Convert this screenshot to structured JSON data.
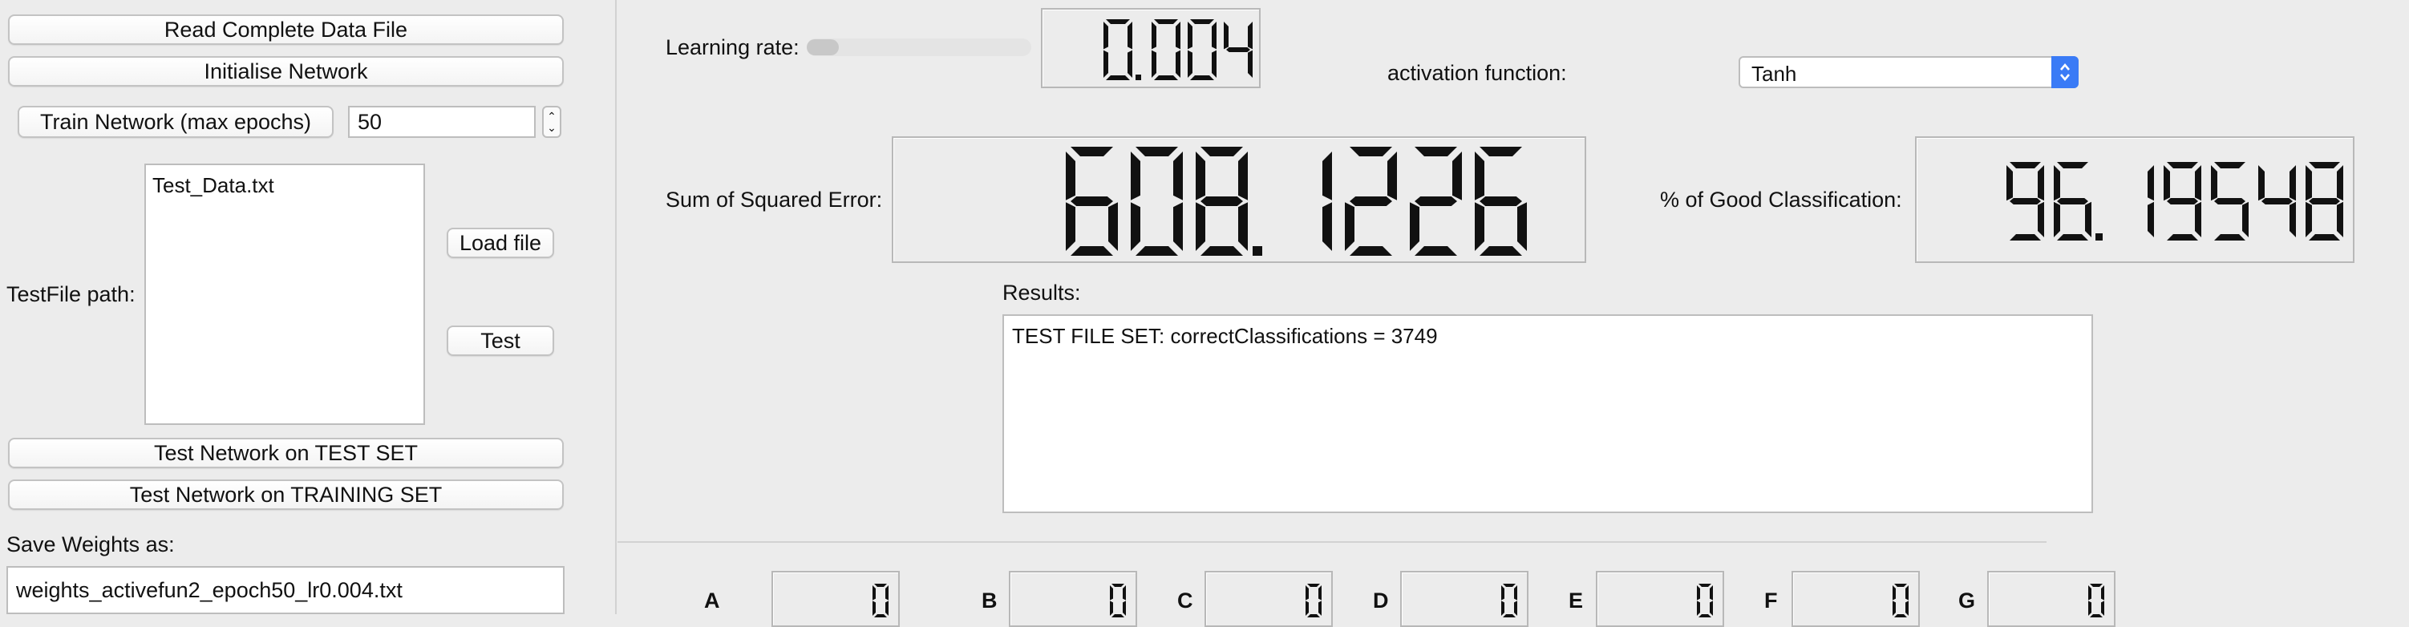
{
  "left_panel": {
    "read_button": "Read Complete Data File",
    "init_button": "Initialise Network",
    "train_button": "Train Network (max epochs)",
    "epochs_value": "50",
    "testfile_label": "TestFile path:",
    "testfile_list": [
      "Test_Data.txt"
    ],
    "load_button": "Load file",
    "test_button": "Test",
    "test_set_button": "Test Network on TEST SET",
    "training_set_button": "Test Network on TRAINING SET",
    "save_label": "Save Weights as:",
    "save_value": "weights_activefun2_epoch50_lr0.004.txt"
  },
  "top": {
    "learning_rate_label": "Learning rate:",
    "learning_rate_fraction": 0.0,
    "learning_rate_display": "0.004",
    "activation_label": "activation function:",
    "activation_value": "Tanh"
  },
  "metrics": {
    "sse_label": "Sum of Squared Error:",
    "sse_display": "608.1226",
    "good_label": "% of Good Classification:",
    "good_display": "96.19548"
  },
  "results": {
    "label": "Results:",
    "text": "TEST FILE SET: correctClassifications = 3749"
  },
  "counters": [
    {
      "label": "A",
      "value": "0"
    },
    {
      "label": "B",
      "value": "0"
    },
    {
      "label": "C",
      "value": "0"
    },
    {
      "label": "D",
      "value": "0"
    },
    {
      "label": "E",
      "value": "0"
    },
    {
      "label": "F",
      "value": "0"
    },
    {
      "label": "G",
      "value": "0"
    }
  ],
  "colors": {
    "accent": "#3a7bf6",
    "background": "#ececec",
    "lcd_digit": "#111111"
  }
}
